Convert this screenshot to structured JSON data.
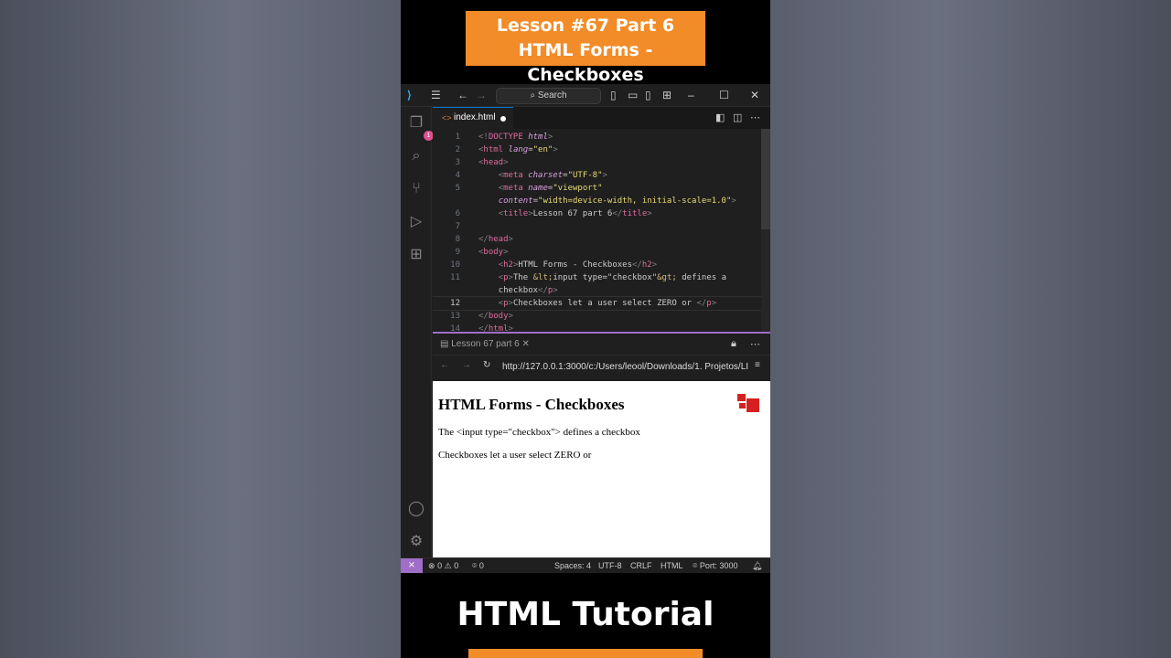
{
  "banner": {
    "line1": "Lesson #67 Part 6",
    "line2": "HTML Forms - Checkboxes"
  },
  "footer_title": "HTML Tutorial",
  "titlebar": {
    "search_label": "Search",
    "icons": [
      "vscode-logo-icon",
      "menu-icon",
      "back-arrow-icon",
      "forward-arrow-icon",
      "search-icon",
      "layout-sidebar-icon",
      "layout-panel-icon",
      "layout-secondary-icon",
      "customize-layout-icon",
      "minimize-icon",
      "maximize-icon",
      "close-icon"
    ]
  },
  "activity_bar": {
    "explorer_badge": "1",
    "icons": [
      "files-icon",
      "search-icon",
      "source-control-icon",
      "run-debug-icon",
      "extensions-icon",
      "account-icon",
      "settings-gear-icon"
    ]
  },
  "editor_tab": {
    "filename": "index.html"
  },
  "code_lines": {
    "n1": "1",
    "n2": "2",
    "n3": "3",
    "n4": "4",
    "n5": "5",
    "n6": "6",
    "n7": "7",
    "n8": "8",
    "n9": "9",
    "n10": "10",
    "n11": "11",
    "n12": "12",
    "n13": "13",
    "n14": "14",
    "l1_doctype": "DOCTYPE",
    "l1_html": "html",
    "l2_tag": "html",
    "l2_attr": "lang",
    "l2_val": "\"en\"",
    "l3_tag": "head",
    "l4_tag": "meta",
    "l4_attr": "charset",
    "l4_val": "\"UTF-8\"",
    "l5_tag": "meta",
    "l5_attr": "name",
    "l5_val": "\"viewport\"",
    "l5b_attr": "content",
    "l5b_val": "\"width=device-width, initial-scale=1.0\"",
    "l6_tag": "title",
    "l6_text": "Lesson 67 part 6",
    "l8_tag": "head",
    "l9_tag": "body",
    "l10_tag": "h2",
    "l10_text": "HTML Forms - Checkboxes",
    "l11_tag": "p",
    "l11_text1": "The ",
    "l11_ent1": "&lt;",
    "l11_text2": "input type=\"checkbox\"",
    "l11_ent2": "&gt;",
    "l11_text3": " defines a",
    "l11b_text": "checkbox",
    "l12_tag": "p",
    "l12_text": "Checkboxes let a user select ZERO or ",
    "l13_tag": "body",
    "l14_tag": "html"
  },
  "preview": {
    "tab_label": "Lesson 67 part 6",
    "url": "http://127.0.0.1:3000/c:/Users/leool/Downloads/1. Projetos/LI",
    "heading": "HTML Forms - Checkboxes",
    "para1": "The <input type=\"checkbox\"> defines a checkbox",
    "para2": "Checkboxes let a user select ZERO or"
  },
  "statusbar": {
    "errors": "0",
    "warnings": "0",
    "ports": "0",
    "spaces": "Spaces: 4",
    "encoding": "UTF-8",
    "eol": "CRLF",
    "language": "HTML",
    "port": "Port: 3000"
  },
  "colors": {
    "banner": "#f28c28",
    "accent": "#a06ec8",
    "tag": "#e06c9f"
  }
}
